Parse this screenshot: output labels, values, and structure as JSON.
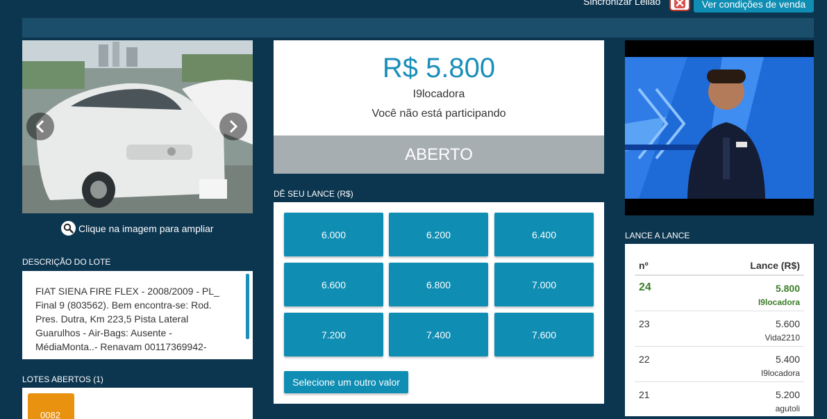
{
  "header": {
    "sync_label": "Sincronizar Leilão",
    "conditions_button": "Ver condições de venda"
  },
  "gallery": {
    "enlarge_label": "Clique na imagem para ampliar"
  },
  "lot_description": {
    "title": "DESCRIÇÃO DO LOTE",
    "text": "FIAT SIENA FIRE FLEX - 2008/2009 - PL_ Final 9 (803562). Bem encontra-se: Rod. Pres. Dutra, Km 223,5 Pista Lateral Guarulhos - Air-Bags: Ausente - MédiaMonta..- Renavam 00117369942-"
  },
  "open_lots": {
    "title": "LOTES ABERTOS (1)",
    "lots": [
      "0082"
    ]
  },
  "auction": {
    "current_price": "R$ 5.800",
    "leader": "I9locadora",
    "participation": "Você não está participando",
    "status": "ABERTO"
  },
  "bid": {
    "title": "DÊ SEU LANCE (R$)",
    "options": [
      "6.000",
      "6.200",
      "6.400",
      "6.600",
      "6.800",
      "7.000",
      "7.200",
      "7.400",
      "7.600"
    ],
    "other_value_button": "Selecione um outro valor"
  },
  "history": {
    "title": "LANCE A LANCE",
    "col_number": "nº",
    "col_value": "Lance (R$)",
    "rows": [
      {
        "n": "24",
        "value": "5.800",
        "user": "I9locadora"
      },
      {
        "n": "23",
        "value": "5.600",
        "user": "Vida2210"
      },
      {
        "n": "22",
        "value": "5.400",
        "user": "I9locadora"
      },
      {
        "n": "21",
        "value": "5.200",
        "user": "agutoli"
      }
    ]
  },
  "colors": {
    "background": "#0c3650",
    "accent": "#0f8db3",
    "price": "#1a8fb8",
    "status_bar": "#a7aeb1",
    "winning_bid": "#3c7d2a",
    "lot_badge": "#e8920f"
  }
}
